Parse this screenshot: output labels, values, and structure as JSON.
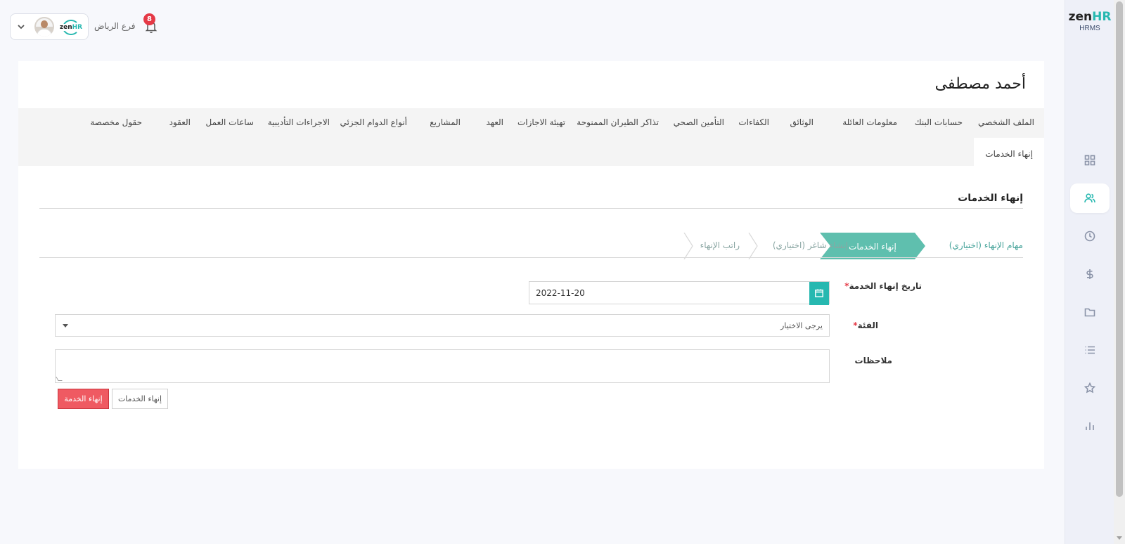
{
  "app": {
    "logo_main": "zen",
    "logo_hr": "HR",
    "logo_sub": "HRMS"
  },
  "header": {
    "branch": "فرع الرياض",
    "notification_count": "8",
    "mini_logo_main": "zen",
    "mini_logo_hr": "HR"
  },
  "sidebar": {
    "items": [
      {
        "icon": "grid-icon",
        "active": false
      },
      {
        "icon": "users-icon",
        "active": true
      },
      {
        "icon": "clock-icon",
        "active": false
      },
      {
        "icon": "dollar-icon",
        "active": false
      },
      {
        "icon": "folder-icon",
        "active": false
      },
      {
        "icon": "list-icon",
        "active": false
      },
      {
        "icon": "star-icon",
        "active": false
      },
      {
        "icon": "bar-chart-icon",
        "active": false
      }
    ]
  },
  "employee": {
    "name": "أحمد مصطفى"
  },
  "tabs": [
    "الملف الشخصي",
    "حسابات البنك",
    "معلومات العائلة",
    "الوثائق",
    "الكفاءات",
    "التأمين الصحي",
    "تذاكر الطيران الممنوحة",
    "تهيئة الاجازات",
    "العهد",
    "المشاريع",
    "أنواع الدوام الجزئي",
    "الاجراءات التأديبية",
    "ساعات العمل",
    "العقود",
    "حقول مخصصة",
    "إنهاء الخدمات"
  ],
  "section": {
    "title": "إنهاء الخدمات"
  },
  "wizard": {
    "steps": [
      {
        "label": "مهام الإنهاء (اختياري)",
        "state": "done"
      },
      {
        "label": "إنهاء الخدمات",
        "state": "active"
      },
      {
        "label": "إنشاء شاغر (اختياري)",
        "state": "future"
      },
      {
        "label": "راتب الإنهاء",
        "state": "future"
      }
    ]
  },
  "form": {
    "end_date_label": "تاريخ إنهاء الخدمة",
    "end_date_value": "2022-11-20",
    "category_label": "الفئة",
    "category_placeholder": "يرجى الاختيار",
    "notes_label": "ملاحظات",
    "required_mark": "*"
  },
  "buttons": {
    "end_service": "إنهاء الخدمة",
    "end_services": "إنهاء الخدمات"
  },
  "colors": {
    "accent": "#27b8b0",
    "danger": "#ef5a62",
    "badge": "#e53946"
  }
}
